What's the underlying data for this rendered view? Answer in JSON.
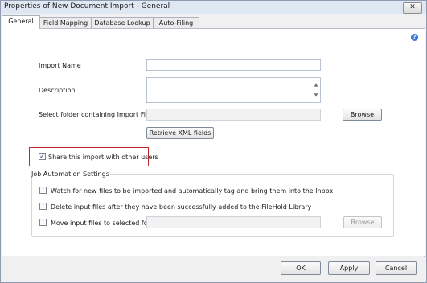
{
  "window": {
    "title": "Properties of New Document Import - General",
    "close_label": "✕"
  },
  "tabs": [
    {
      "label": "General"
    },
    {
      "label": "Field Mapping"
    },
    {
      "label": "Database Lookup"
    },
    {
      "label": "Auto-Filing"
    }
  ],
  "general": {
    "help_icon": "?",
    "import_name_label": "Import Name",
    "import_name_value": "",
    "description_label": "Description",
    "description_value": "",
    "folder_label": "Select folder containing Import File",
    "folder_value": "",
    "browse_label": "Browse",
    "retrieve_label": "Retrieve XML fields",
    "share_label": "Share this import with other users",
    "share_checked": "✓"
  },
  "job_automation": {
    "title": "Job Automation Settings",
    "watch_label": "Watch for new files to be imported and automatically tag and bring them into the Inbox",
    "delete_label": "Delete input files after they have been successfully added to the FileHold Library",
    "move_label": "Move input files to selected folder:",
    "move_folder_value": "",
    "browse_label": "Browse"
  },
  "footer": {
    "ok_label": "OK",
    "apply_label": "Apply",
    "cancel_label": "Cancel"
  }
}
